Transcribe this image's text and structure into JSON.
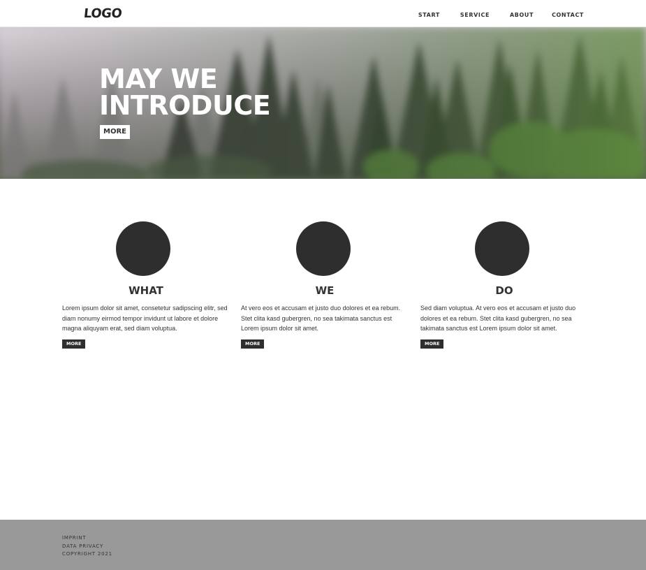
{
  "header": {
    "logo": "LOGO",
    "nav": [
      "START",
      "SERVICE",
      "ABOUT",
      "CONTACT"
    ]
  },
  "hero": {
    "title_line1": "MAY WE",
    "title_line2": "INTRODUCE",
    "button_label": "MORE"
  },
  "features": [
    {
      "heading": "WHAT",
      "text": "Lorem ipsum dolor sit amet, consetetur sadipscing elitr, sed diam nonumy eirmod tempor invidunt ut labore et dolore magna aliquyam erat, sed diam voluptua.",
      "button_label": "MORE"
    },
    {
      "heading": "WE",
      "text": "At vero eos et accusam et justo duo dolores et ea rebum. Stet clita kasd gubergren, no sea takimata sanctus est Lorem ipsum dolor sit amet.",
      "button_label": "MORE"
    },
    {
      "heading": "DO",
      "text": "Sed diam voluptua. At vero eos et accusam et justo duo dolores et ea rebum. Stet clita kasd gubergren, no sea takimata sanctus est Lorem ipsum dolor sit amet.",
      "button_label": "MORE"
    }
  ],
  "footer": {
    "links": [
      "IMPRINT",
      "DATA PRIVACY",
      "COPYRIGHT 2021"
    ]
  },
  "colors": {
    "dark": "#2e2e2e",
    "footer_bg": "#999999",
    "text": "#333333"
  }
}
